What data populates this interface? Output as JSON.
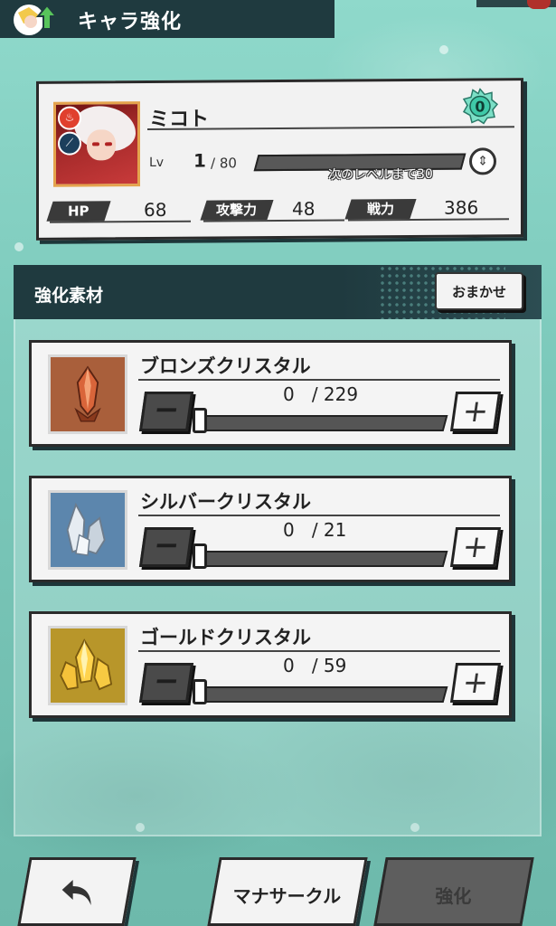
{
  "header": {
    "title": "キャラ強化",
    "icon": "character-up-icon"
  },
  "character": {
    "name": "ミコト",
    "rank": "0",
    "level_label": "Lv",
    "level_current": "1",
    "level_max": "/ 80",
    "exp_note": "次のレベルまで30",
    "element_icon": "fire-icon",
    "weapon_icon": "sword-icon",
    "stats": [
      {
        "label": "HP",
        "value": "68"
      },
      {
        "label": "攻撃力",
        "value": "48"
      },
      {
        "label": "戦力",
        "value": "386"
      }
    ]
  },
  "materials_panel": {
    "title": "強化素材",
    "auto_button": "おまかせ",
    "items": [
      {
        "name": "ブロンズクリスタル",
        "count": "0",
        "max": "/ 229",
        "icon": "bronze-crystal-icon",
        "color": "#b76b44"
      },
      {
        "name": "シルバークリスタル",
        "count": "0",
        "max": "/ 21",
        "icon": "silver-crystal-icon",
        "color": "#5c86ad"
      },
      {
        "name": "ゴールドクリスタル",
        "count": "0",
        "max": "/ 59",
        "icon": "gold-crystal-icon",
        "color": "#b8962a"
      }
    ],
    "minus_label": "−",
    "plus_label": "+"
  },
  "footer": {
    "back_icon": "back-arrow-icon",
    "mana_circle": "マナサークル",
    "enhance": "強化"
  },
  "colors": {
    "background": "#7cc9bb",
    "dark_panel": "#1f3a3f",
    "rank_green": "#3fc9a8"
  }
}
